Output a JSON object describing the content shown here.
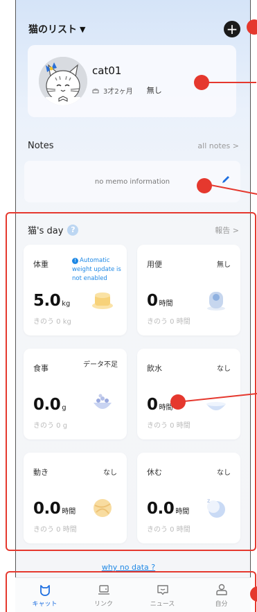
{
  "header": {
    "title": "猫のリスト",
    "caret": "▼",
    "add_symbol": "+"
  },
  "cat": {
    "name": "cat01",
    "age": "3才2ヶ月",
    "status": "無し"
  },
  "notes": {
    "title": "Notes",
    "all_link": "all notes >",
    "empty_text": "no memo information"
  },
  "day": {
    "title": "猫's day",
    "help": "?",
    "report_link": "報告 >",
    "tiles": [
      {
        "name": "体重",
        "status": "",
        "note": "Automatic weight update is not enabled",
        "value": "5.0",
        "unit": "kg",
        "yesterday": "きのう 0 kg",
        "icon": "scale-food-icon"
      },
      {
        "name": "用便",
        "status": "無し",
        "note": "",
        "value": "0",
        "unit": "時間",
        "yesterday": "きのう 0 時間",
        "icon": "litter-box-icon"
      },
      {
        "name": "食事",
        "status": "データ不足",
        "note": "",
        "value": "0.0",
        "unit": "g",
        "yesterday": "きのう 0 g",
        "icon": "food-bowl-icon"
      },
      {
        "name": "飲水",
        "status": "なし",
        "note": "",
        "value": "0",
        "unit": "時間",
        "yesterday": "きのう 0 時間",
        "icon": "water-bowl-icon"
      },
      {
        "name": "動き",
        "status": "なし",
        "note": "",
        "value": "0.0",
        "unit": "時間",
        "yesterday": "きのう 0 時間",
        "icon": "yarn-ball-icon"
      },
      {
        "name": "休む",
        "status": "なし",
        "note": "",
        "value": "0.0",
        "unit": "時間",
        "yesterday": "きのう 0 時間",
        "icon": "sleep-moon-icon"
      }
    ]
  },
  "why_link": "why no data ?",
  "tabs": [
    {
      "label": "キャット",
      "icon": "cat-icon",
      "active": true
    },
    {
      "label": "リンク",
      "icon": "laptop-icon",
      "active": false
    },
    {
      "label": "ニュース",
      "icon": "message-icon",
      "active": false
    },
    {
      "label": "自分",
      "icon": "person-icon",
      "active": false
    }
  ],
  "colors": {
    "accent": "#1e6fe0",
    "link": "#1e88e5",
    "annotation": "#e5382e"
  }
}
